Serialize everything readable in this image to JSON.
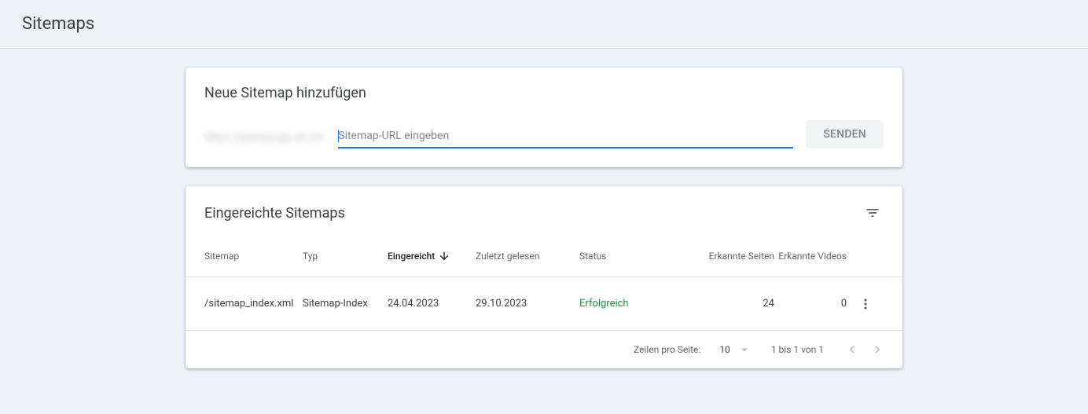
{
  "page_title": "Sitemaps",
  "add_card": {
    "title": "Neue Sitemap hinzufügen",
    "url_prefix": "https://pranayoga-ah.ch/",
    "placeholder": "Sitemap-URL eingeben",
    "submit_label": "SENDEN"
  },
  "list_card": {
    "title": "Eingereichte Sitemaps",
    "columns": {
      "sitemap": "Sitemap",
      "type": "Typ",
      "submitted": "Eingereicht",
      "last_read": "Zuletzt gelesen",
      "status": "Status",
      "pages": "Erkannte Seiten",
      "videos": "Erkannte Videos"
    },
    "rows": [
      {
        "sitemap": "/sitemap_index.xml",
        "type": "Sitemap-Index",
        "submitted": "24.04.2023",
        "last_read": "29.10.2023",
        "status": "Erfolgreich",
        "pages": "24",
        "videos": "0"
      }
    ],
    "pagination": {
      "rows_per_page_label": "Zeilen pro Seite:",
      "rows_per_page_value": "10",
      "range": "1 bis 1 von 1"
    }
  }
}
